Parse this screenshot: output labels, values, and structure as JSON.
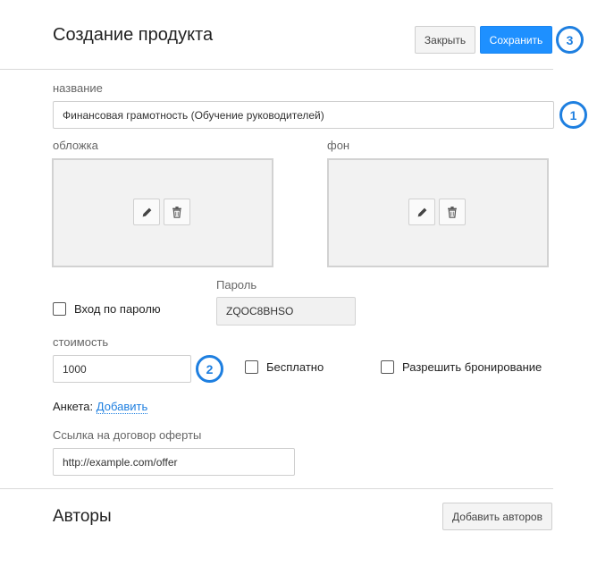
{
  "header": {
    "title": "Создание продукта",
    "close_label": "Закрыть",
    "save_label": "Сохранить",
    "badge_save": "3"
  },
  "form": {
    "name_label": "название",
    "name_value": "Финансовая грамотность (Обучение руководителей)",
    "badge_name": "1",
    "cover_label": "обложка",
    "background_label": "фон",
    "password_login_label": "Вход по паролю",
    "password_label": "Пароль",
    "password_value": "ZQOC8BHSO",
    "cost_label": "стоимость",
    "cost_value": "1000",
    "badge_cost": "2",
    "free_label": "Бесплатно",
    "allow_booking_label": "Разрешить бронирование",
    "survey_label": "Анкета:",
    "survey_add_link": "Добавить",
    "offer_label": "Ссылка на договор оферты",
    "offer_placeholder": "http://example.com/offer"
  },
  "authors": {
    "title": "Авторы",
    "add_authors_label": "Добавить авторов"
  },
  "colors": {
    "accent": "#1e90ff",
    "badge": "#1e7fe0"
  }
}
